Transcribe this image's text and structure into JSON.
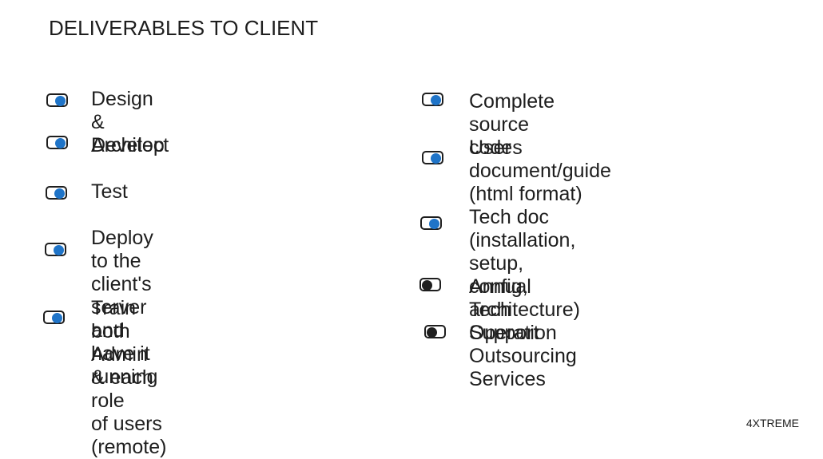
{
  "title": "DELIVERABLES TO CLIENT",
  "left_items": [
    {
      "label": "Design & Architect",
      "state": "on"
    },
    {
      "label": "Develop",
      "state": "on"
    },
    {
      "label": "Test",
      "state": "on"
    },
    {
      "label": "Deploy to the client's server\nand have it running",
      "state": "on"
    },
    {
      "label": "Train both Admin & each role\nof users (remote)",
      "state": "on"
    }
  ],
  "right_items": [
    {
      "label": "Complete source codes",
      "state": "on"
    },
    {
      "label": "User document/guide\n(html format)",
      "state": "on"
    },
    {
      "label": "Tech doc (installation, setup, config,\narchitecture)",
      "state": "on"
    },
    {
      "label": "Annual Tech Support",
      "state": "off"
    },
    {
      "label": "Operation Outsourcing Services",
      "state": "off"
    }
  ],
  "footer": "4XTREME",
  "colors": {
    "toggle_on": "#1f74c8",
    "toggle_off": "#1e1e1e",
    "text": "#1e1e1e"
  }
}
